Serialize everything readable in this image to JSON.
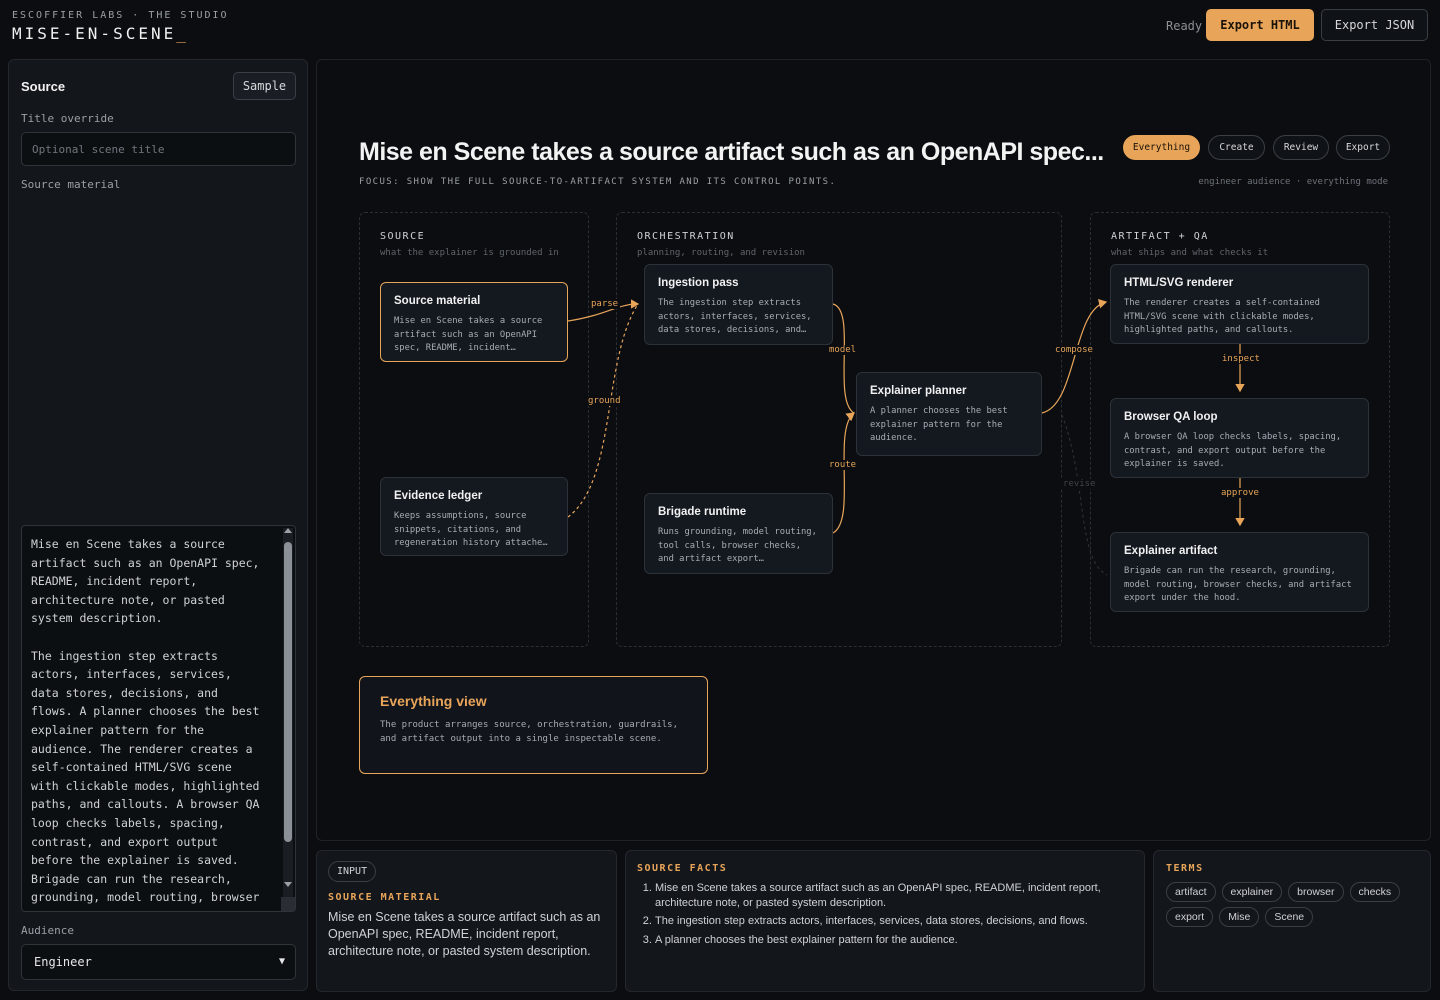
{
  "header": {
    "kicker": "ESCOFFIER LABS · THE STUDIO",
    "title": "MISE-EN-SCENE",
    "cursor": "_",
    "status": "Ready",
    "export_html_label": "Export HTML",
    "export_json_label": "Export JSON",
    "accent_color": "#e8a55a"
  },
  "source_panel": {
    "heading": "Source",
    "sample_label": "Sample",
    "title_override_label": "Title override",
    "title_override_value": "",
    "title_override_placeholder": "Optional scene title",
    "source_material_label": "Source material",
    "source_material_text": "Mise en Scene takes a source\nartifact such as an OpenAPI spec,\nREADME, incident report,\narchitecture note, or pasted\nsystem description.\n\nThe ingestion step extracts\nactors, interfaces, services,\ndata stores, decisions, and\nflows. A planner chooses the best\nexplainer pattern for the\naudience. The renderer creates a\nself-contained HTML/SVG scene\nwith clickable modes, highlighted\npaths, and callouts. A browser QA\nloop checks labels, spacing,\ncontrast, and export output\nbefore the explainer is saved.\nBrigade can run the research,\ngrounding, model routing, browser",
    "audience_label": "Audience",
    "audience_value": "Engineer"
  },
  "scene": {
    "title": "Mise en Scene takes a source artifact such as an OpenAPI spec...",
    "focus": "FOCUS: SHOW THE FULL SOURCE-TO-ARTIFACT SYSTEM AND ITS CONTROL POINTS.",
    "meta": "engineer audience · everything mode",
    "modes": [
      "Everything",
      "Create",
      "Review",
      "Export"
    ],
    "active_mode": "Everything",
    "lanes": [
      {
        "title": "SOURCE",
        "subtitle": "what the explainer is grounded in"
      },
      {
        "title": "ORCHESTRATION",
        "subtitle": "planning, routing, and revision"
      },
      {
        "title": "ARTIFACT + QA",
        "subtitle": "what ships and what checks it"
      }
    ],
    "nodes": {
      "source_material": {
        "title": "Source material",
        "desc": "Mise en Scene takes a source artifact such as an OpenAPI spec, README, incident…"
      },
      "evidence_ledger": {
        "title": "Evidence ledger",
        "desc": "Keeps assumptions, source snippets, citations, and regeneration history attache…"
      },
      "ingestion_pass": {
        "title": "Ingestion pass",
        "desc": "The ingestion step extracts actors, interfaces, services, data stores, decisions, and…"
      },
      "brigade_runtime": {
        "title": "Brigade runtime",
        "desc": "Runs grounding, model routing, tool calls, browser checks, and artifact export…"
      },
      "explainer_planner": {
        "title": "Explainer planner",
        "desc": "A planner chooses the best explainer pattern for the audience."
      },
      "html_renderer": {
        "title": "HTML/SVG renderer",
        "desc": "The renderer creates a self-contained HTML/SVG scene with clickable modes, highlighted paths, and callouts."
      },
      "browser_qa": {
        "title": "Browser QA loop",
        "desc": "A browser QA loop checks labels, spacing, contrast, and export output before the explainer is saved."
      },
      "explainer_artifact": {
        "title": "Explainer artifact",
        "desc": "Brigade can run the research, grounding, model routing, browser checks, and artifact export under the hood."
      }
    },
    "edges": {
      "parse": "parse",
      "ground": "ground",
      "model": "model",
      "route": "route",
      "compose": "compose",
      "inspect": "inspect",
      "approve": "approve",
      "revise": "revise"
    },
    "callout": {
      "title": "Everything view",
      "body": "The product arranges source, orchestration, guardrails, and artifact output into a single inspectable scene."
    }
  },
  "bottom": {
    "input": {
      "chip": "INPUT",
      "label": "SOURCE MATERIAL",
      "text": "Mise en Scene takes a source artifact such as an OpenAPI spec, README, incident report, architecture note, or pasted system description."
    },
    "facts": {
      "label": "SOURCE FACTS",
      "items": [
        "Mise en Scene takes a source artifact such as an OpenAPI spec, README, incident report, architecture note, or pasted system description.",
        "The ingestion step extracts actors, interfaces, services, data stores, decisions, and flows.",
        "A planner chooses the best explainer pattern for the audience."
      ]
    },
    "terms": {
      "label": "TERMS",
      "items": [
        "artifact",
        "explainer",
        "browser",
        "checks",
        "export",
        "Mise",
        "Scene"
      ]
    }
  }
}
